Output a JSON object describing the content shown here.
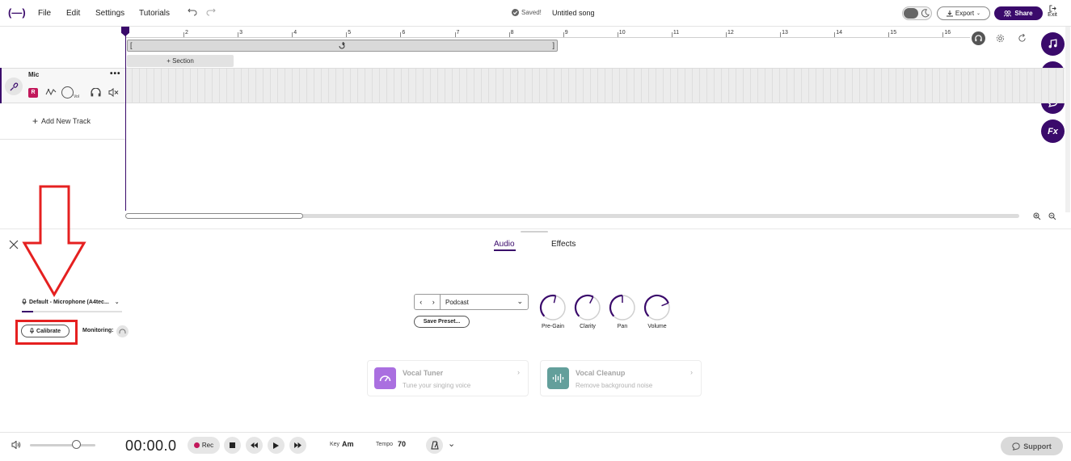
{
  "topbar": {
    "logo": "(—)",
    "menu": [
      "File",
      "Edit",
      "Settings",
      "Tutorials"
    ],
    "saved_status": "Saved!",
    "song_title": "Untitled song",
    "export_label": "Export",
    "share_label": "Share",
    "exit_label": "Exit"
  },
  "timeline": {
    "ticks": [
      "2",
      "3",
      "4",
      "5",
      "6",
      "7",
      "8",
      "9",
      "10",
      "11",
      "12",
      "13",
      "14",
      "15",
      "16"
    ],
    "section_label": "+ Section"
  },
  "track": {
    "name": "Mic",
    "rec_badge": "R",
    "vol_label": "Vol",
    "add_track_label": "Add New Track"
  },
  "audio_panel": {
    "tabs": [
      "Audio",
      "Effects"
    ],
    "active_tab": "Audio",
    "mic_device": "Default - Microphone (A4tec...",
    "mic_level": 0.11,
    "calibrate_label": "Calibrate",
    "monitoring_label": "Monitoring:",
    "preset_name": "Podcast",
    "save_preset_label": "Save Preset...",
    "knobs": [
      {
        "label": "Pre-Gain",
        "value": 0.55
      },
      {
        "label": "Clarity",
        "value": 0.6
      },
      {
        "label": "Pan",
        "value": 0.5
      },
      {
        "label": "Volume",
        "value": 0.75
      }
    ],
    "features": [
      {
        "title": "Vocal Tuner",
        "subtitle": "Tune your singing voice",
        "color": "#8e3fd6",
        "icon": "tuner-icon"
      },
      {
        "title": "Vocal Cleanup",
        "subtitle": "Remove background noise",
        "color": "#2f7f7a",
        "icon": "waveform-icon"
      }
    ]
  },
  "transport": {
    "volume_level": 0.7,
    "timecode": "00:00.0",
    "rec_label": "Rec",
    "key_label": "Key",
    "key_value": "Am",
    "tempo_label": "Tempo",
    "tempo_value": "70",
    "support_label": "Support"
  },
  "colors": {
    "accent": "#3a0a6b",
    "record": "#c2185b",
    "annotation": "#e52020"
  }
}
